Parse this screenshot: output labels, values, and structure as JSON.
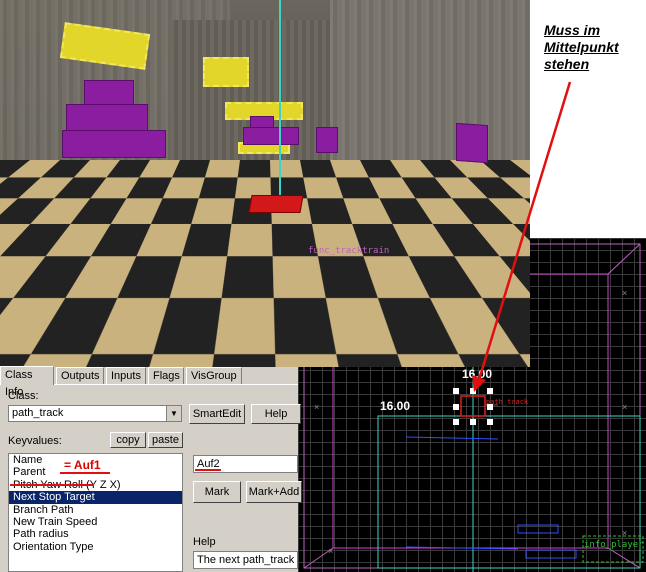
{
  "annotation": {
    "lines": [
      "Muss im",
      "Mittelpunkt",
      "stehen"
    ],
    "arrow_color": "#e01010"
  },
  "properties_dialog": {
    "tabs": [
      "Class Info",
      "Outputs",
      "Inputs",
      "Flags",
      "VisGroup"
    ],
    "active_tab": "Class Info",
    "class_label": "Class:",
    "class_value": "path_track",
    "smartedit_label": "SmartEdit",
    "help_button_label": "Help",
    "keyvalues_label": "Keyvalues:",
    "copy_label": "copy",
    "paste_label": "paste",
    "keyvalues": [
      "Name",
      "Parent",
      "Pitch Yaw Roll (Y Z X)",
      "Next Stop Target",
      "Branch Path",
      "New Train Speed",
      "Path radius",
      "Orientation Type"
    ],
    "selected_keyvalue": "Next Stop Target",
    "name_annotation": "= Auf1",
    "value_field": "Auf2",
    "mark_label": "Mark",
    "mark_add_label": "Mark+Add",
    "help_label": "Help",
    "help_text": "The next path_track"
  },
  "grid_view": {
    "entity_labels": [
      "func_tracktrain",
      "trigger_multiple",
      "path_track"
    ],
    "dimension_x": "16.00",
    "dimension_y": "16.00",
    "corner_label": "info_player",
    "colors": {
      "tracktrain": "#c060c0",
      "trigger": "#d040d0",
      "cyan": "#3fd3c8",
      "path": "#e02020",
      "blue_links": "#3050ff",
      "green": "#30c030"
    }
  },
  "colors": {
    "selection_blue": "#0a246a",
    "dialog_face": "#d4d0c8",
    "accent_red": "#e01010"
  }
}
